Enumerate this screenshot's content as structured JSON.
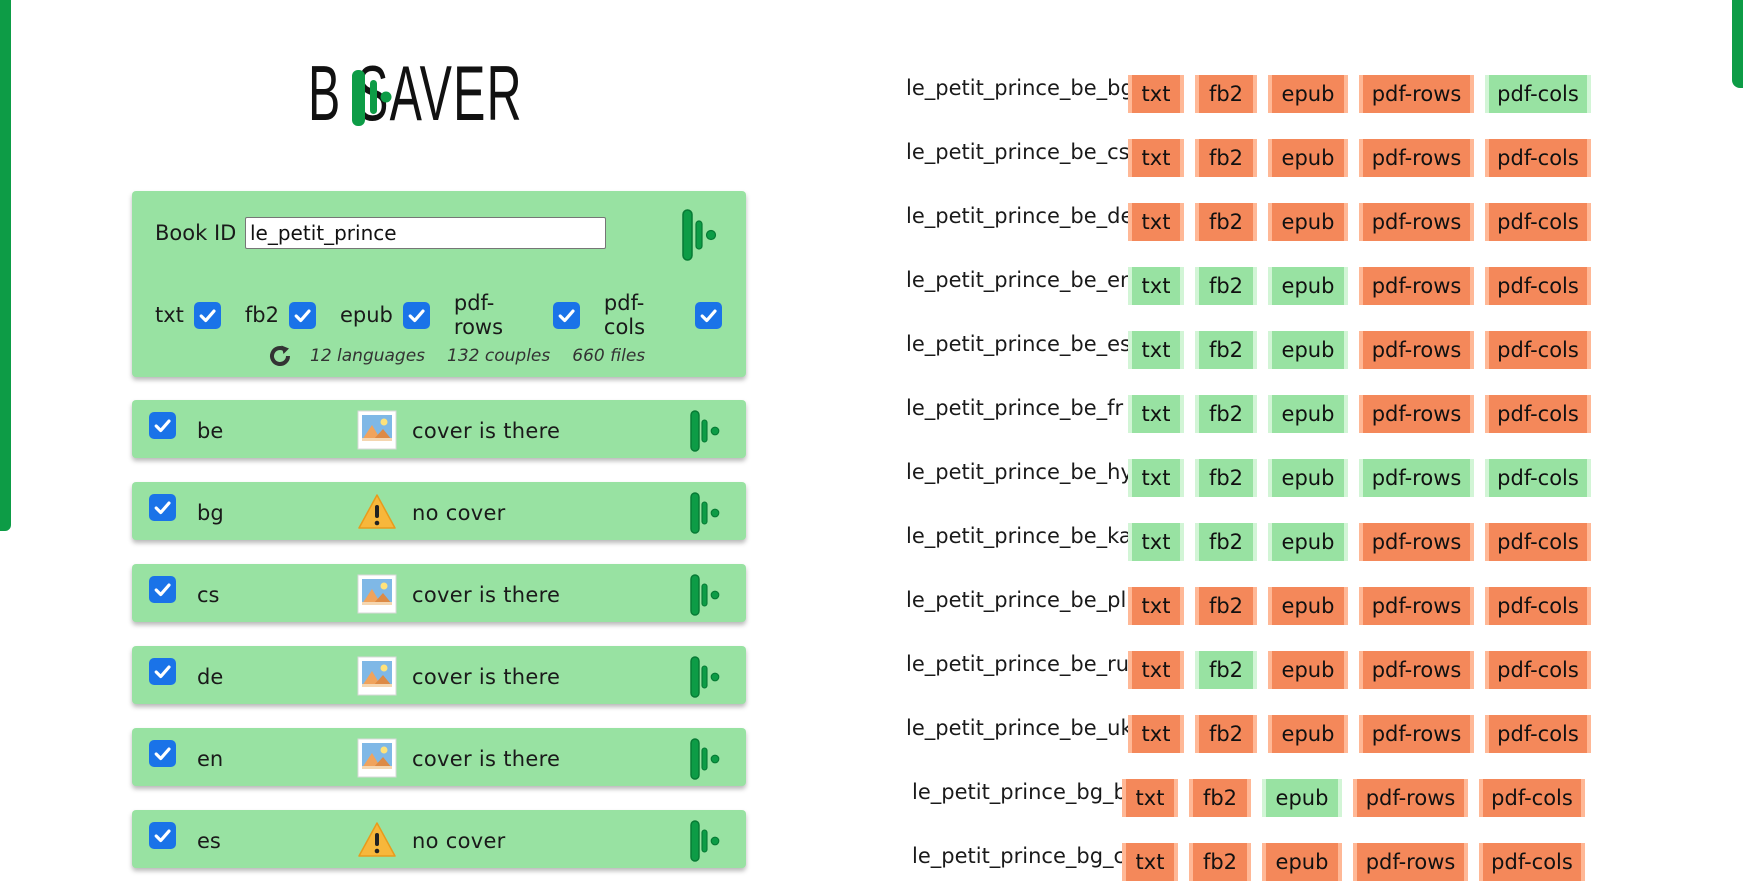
{
  "app": {
    "logo_text": "B  SAVER"
  },
  "form": {
    "book_id_label": "Book ID",
    "book_id_value": "le_petit_prince",
    "formats": [
      {
        "label": "txt",
        "checked": true
      },
      {
        "label": "fb2",
        "checked": true
      },
      {
        "label": "epub",
        "checked": true
      },
      {
        "label": "pdf-rows",
        "checked": true
      },
      {
        "label": "pdf-cols",
        "checked": true
      }
    ],
    "stats": {
      "languages": "12 languages",
      "couples": "132 couples",
      "files": "660 files"
    }
  },
  "languages": [
    {
      "code": "be",
      "cover": true,
      "status": "cover is there"
    },
    {
      "code": "bg",
      "cover": false,
      "status": "no cover"
    },
    {
      "code": "cs",
      "cover": true,
      "status": "cover is there"
    },
    {
      "code": "de",
      "cover": true,
      "status": "cover is there"
    },
    {
      "code": "en",
      "cover": true,
      "status": "cover is there"
    },
    {
      "code": "es",
      "cover": false,
      "status": "no cover"
    }
  ],
  "format_labels": [
    "txt",
    "fb2",
    "epub",
    "pdf-rows",
    "pdf-cols"
  ],
  "files": [
    {
      "name": "le_petit_prince_be_bg",
      "status": [
        "bad",
        "bad",
        "bad",
        "bad",
        "ok"
      ]
    },
    {
      "name": "le_petit_prince_be_cs",
      "status": [
        "bad",
        "bad",
        "bad",
        "bad",
        "bad"
      ]
    },
    {
      "name": "le_petit_prince_be_de",
      "status": [
        "bad",
        "bad",
        "bad",
        "bad",
        "bad"
      ]
    },
    {
      "name": "le_petit_prince_be_en",
      "status": [
        "ok",
        "ok",
        "ok",
        "bad",
        "bad"
      ]
    },
    {
      "name": "le_petit_prince_be_es",
      "status": [
        "ok",
        "ok",
        "ok",
        "bad",
        "bad"
      ]
    },
    {
      "name": "le_petit_prince_be_fr",
      "status": [
        "ok",
        "ok",
        "ok",
        "bad",
        "bad"
      ]
    },
    {
      "name": "le_petit_prince_be_hy",
      "status": [
        "ok",
        "ok",
        "ok",
        "ok",
        "ok"
      ]
    },
    {
      "name": "le_petit_prince_be_ka",
      "status": [
        "ok",
        "ok",
        "ok",
        "bad",
        "bad"
      ]
    },
    {
      "name": "le_petit_prince_be_pl",
      "status": [
        "bad",
        "bad",
        "bad",
        "bad",
        "bad"
      ]
    },
    {
      "name": "le_petit_prince_be_ru",
      "status": [
        "bad",
        "ok",
        "bad",
        "bad",
        "bad"
      ]
    },
    {
      "name": "le_petit_prince_be_uk",
      "status": [
        "bad",
        "bad",
        "bad",
        "bad",
        "bad"
      ]
    },
    {
      "name": "le_petit_prince_bg_be",
      "status": [
        "bad",
        "bad",
        "ok",
        "bad",
        "bad"
      ]
    },
    {
      "name": "le_petit_prince_bg_cs",
      "status": [
        "bad",
        "bad",
        "bad",
        "bad",
        "bad"
      ]
    }
  ],
  "colors": {
    "accent": "#0d9c46",
    "panel": "#98e2a2",
    "missing": "#f4885a",
    "present": "#98e2a2",
    "checkbox": "#1a73e8"
  }
}
